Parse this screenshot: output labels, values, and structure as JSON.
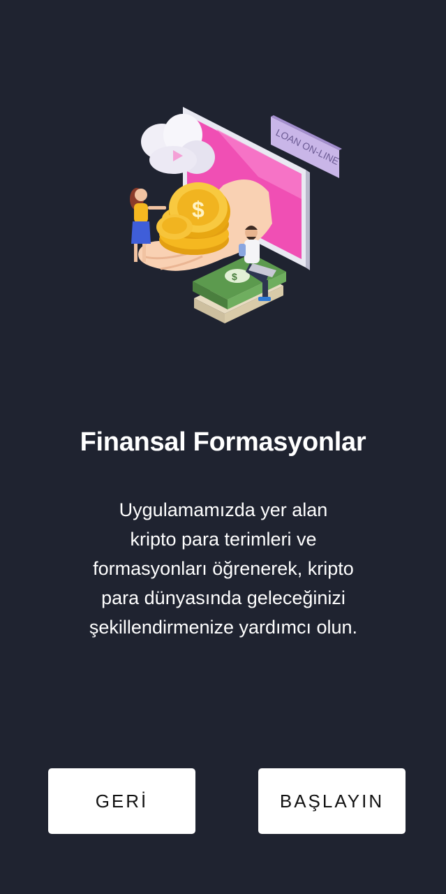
{
  "onboarding": {
    "illustration": {
      "icon": "online-loan-illustration",
      "sign_text": "LOAN ON-LINE",
      "coin_symbol": "$",
      "colors": {
        "screen": "#f04fb4",
        "sign": "#c9b6e8",
        "coin": "#f5b820",
        "cash": "#5c9a4e"
      }
    },
    "title": "Finansal Formasyonlar",
    "description_lines": [
      "Uygulamamızda yer alan",
      "kripto para terimleri ve",
      "formasyonları öğrenerek, kripto",
      "para dünyasında geleceğinizi",
      "şekillendirmenize yardımcı olun."
    ]
  },
  "buttons": {
    "back_label": "GERİ",
    "start_label": "BAŞLAYIN"
  },
  "colors": {
    "background": "#1f2330",
    "button_bg": "#ffffff",
    "text": "#ffffff"
  }
}
